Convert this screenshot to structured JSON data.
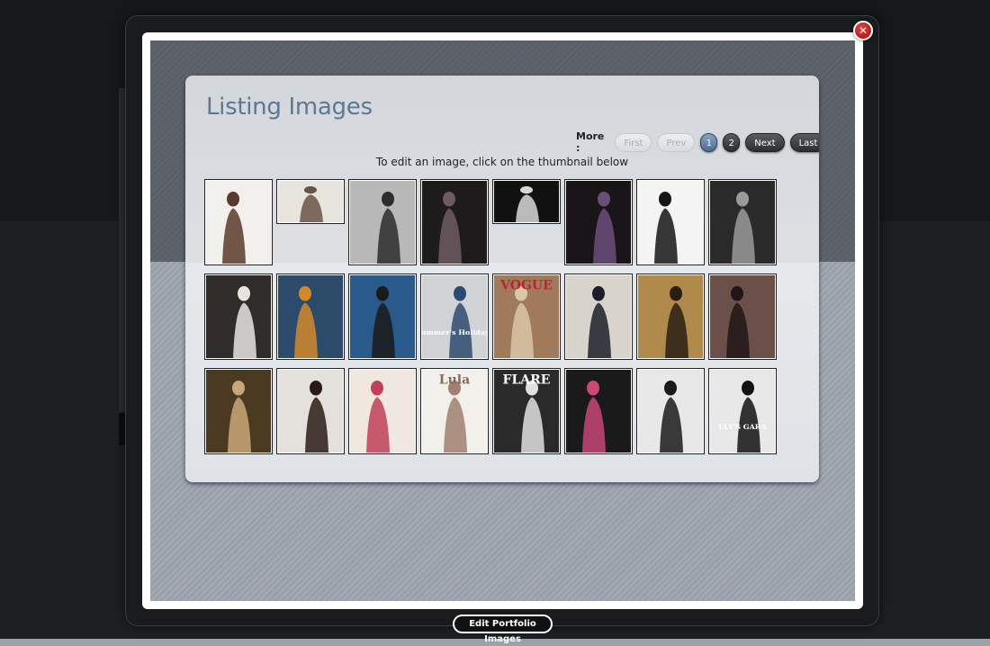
{
  "panel": {
    "title": "Listing Images",
    "instruction": "To edit an image, click on the thumbnail below"
  },
  "pager": {
    "label": "More :",
    "first": "First",
    "prev": "Prev",
    "pages": [
      "1",
      "2"
    ],
    "current": "1",
    "next": "Next",
    "last": "Last"
  },
  "thumbnails": [
    {
      "row": 1,
      "bg": "#f2f0ec",
      "fg": "#5a3a2a",
      "size": "full"
    },
    {
      "row": 1,
      "bg": "#e8e4de",
      "fg": "#6a5448",
      "size": "short"
    },
    {
      "row": 1,
      "bg": "#b8b8b8",
      "fg": "#2c2c2c",
      "size": "full"
    },
    {
      "row": 1,
      "bg": "#1e1b1d",
      "fg": "#6e5a62",
      "size": "full"
    },
    {
      "row": 1,
      "bg": "#111111",
      "fg": "#d8d8d8",
      "size": "short"
    },
    {
      "row": 1,
      "bg": "#191519",
      "fg": "#6a4e7a",
      "size": "full"
    },
    {
      "row": 1,
      "bg": "#f4f4f4",
      "fg": "#151515",
      "size": "full"
    },
    {
      "row": 1,
      "bg": "#2a2a2a",
      "fg": "#9a9a9a",
      "size": "full"
    },
    {
      "row": 2,
      "bg": "#302c2a",
      "fg": "#e8e4e0",
      "size": "full"
    },
    {
      "row": 2,
      "bg": "#2c4a6a",
      "fg": "#d08a2a",
      "size": "full"
    },
    {
      "row": 2,
      "bg": "#2a5a8c",
      "fg": "#1a1a1a",
      "size": "full"
    },
    {
      "row": 2,
      "bg": "#cfd3d6",
      "fg": "#2e4a6e",
      "size": "full",
      "text": "Summer's Holidays"
    },
    {
      "row": 2,
      "bg": "#a07a5a",
      "fg": "#d8c8a8",
      "size": "full",
      "text": "VOGUE"
    },
    {
      "row": 2,
      "bg": "#d8d4cc",
      "fg": "#1e1e2a",
      "size": "full"
    },
    {
      "row": 2,
      "bg": "#b08a4a",
      "fg": "#2a1e14",
      "size": "full"
    },
    {
      "row": 2,
      "bg": "#6a5048",
      "fg": "#1e1618",
      "size": "full"
    },
    {
      "row": 3,
      "bg": "#4a3a22",
      "fg": "#c8a878",
      "size": "full"
    },
    {
      "row": 3,
      "bg": "#e4e0dc",
      "fg": "#2a1a14",
      "size": "full"
    },
    {
      "row": 3,
      "bg": "#f0e8e0",
      "fg": "#c04058",
      "size": "full"
    },
    {
      "row": 3,
      "bg": "#f2f0ea",
      "fg": "#a08070",
      "size": "full",
      "text": "Lula"
    },
    {
      "row": 3,
      "bg": "#2a2a2a",
      "fg": "#e0e0e0",
      "size": "full",
      "text": "FLARE"
    },
    {
      "row": 3,
      "bg": "#1a1a1a",
      "fg": "#c84878",
      "size": "full"
    },
    {
      "row": 3,
      "bg": "#e8e8e8",
      "fg": "#1a1a1a",
      "size": "full"
    },
    {
      "row": 3,
      "bg": "#e8e8e8",
      "fg": "#121212",
      "size": "full",
      "text": "LLY'S GARA"
    }
  ],
  "footer": {
    "caption": "Edit Portfolio Images"
  },
  "colors": {
    "title": "#5d7896",
    "active_page": "#5a7898",
    "close": "#c0141a"
  }
}
